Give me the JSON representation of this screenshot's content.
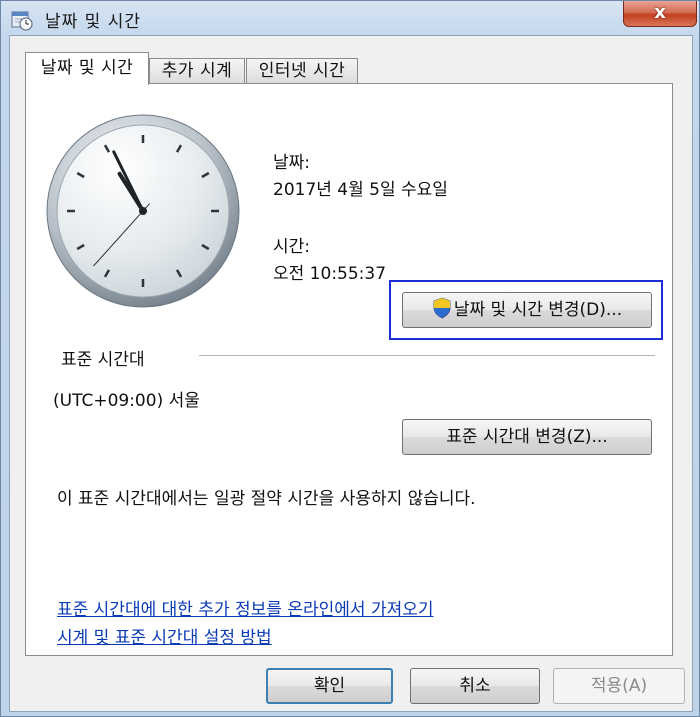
{
  "window": {
    "title": "날짜 및 시간",
    "close_label": "x"
  },
  "tabs": [
    {
      "label": "날짜 및 시간",
      "active": true
    },
    {
      "label": "추가 시계",
      "active": false
    },
    {
      "label": "인터넷 시간",
      "active": false
    }
  ],
  "clock": {
    "hour": 10,
    "minute": 55,
    "second": 37
  },
  "date": {
    "label": "날짜:",
    "value": "2017년 4월 5일 수요일"
  },
  "time": {
    "label": "시간:",
    "value": "오전 10:55:37"
  },
  "change_datetime_button": {
    "label": "날짜 및 시간 변경(D)...",
    "icon": "uac-shield-icon"
  },
  "timezone": {
    "section_label": "표준 시간대",
    "value": "(UTC+09:00) 서울",
    "change_button_label": "표준 시간대 변경(Z)...",
    "dst_note": "이 표준 시간대에서는 일광 절약 시간을 사용하지 않습니다."
  },
  "links": {
    "more_info": "표준 시간대에 대한 추가 정보를 온라인에서 가져오기",
    "how_to": "시계 및 표준 시간대 설정 방법"
  },
  "footer": {
    "ok": "확인",
    "cancel": "취소",
    "apply": "적용(A)"
  },
  "colors": {
    "highlight_box": "#1c2fd6",
    "link": "#0b3bb5"
  }
}
